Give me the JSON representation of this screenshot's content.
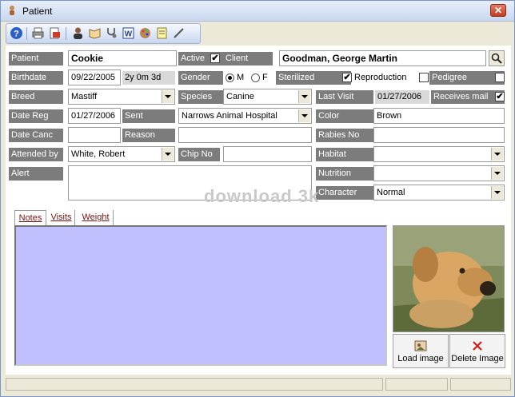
{
  "window": {
    "title": "Patient",
    "close_label": "✕"
  },
  "toolbar": {
    "icons": [
      "help-icon",
      "print-icon",
      "report-icon",
      "person-icon",
      "book-icon",
      "stethoscope-icon",
      "word-icon",
      "palette-icon",
      "note-icon",
      "pen-icon"
    ]
  },
  "labels": {
    "patient": "Patient",
    "active": "Active",
    "client": "Client",
    "birthdate": "Birthdate",
    "gender": "Gender",
    "sterilized": "Sterilized",
    "reproduction": "Reproduction",
    "pedigree": "Pedigree",
    "breed": "Breed",
    "species": "Species",
    "last_visit": "Last Visit",
    "receives_mail": "Receives mail",
    "date_reg": "Date Reg",
    "sent": "Sent",
    "color": "Color",
    "date_canc": "Date Canc",
    "reason": "Reason",
    "rabies_no": "Rabies No",
    "attended_by": "Attended by",
    "chip_no": "Chip No",
    "habitat": "Habitat",
    "alert": "Alert",
    "nutrition": "Nutrition",
    "character": "Character",
    "gender_m": "M",
    "gender_f": "F"
  },
  "values": {
    "patient": "Cookie",
    "client": "Goodman, George Martin",
    "birthdate": "09/22/2005",
    "age": "2y 0m 3d",
    "breed": "Mastiff",
    "species": "Canine",
    "last_visit": "01/27/2006",
    "date_reg": "01/27/2006",
    "sent": "Narrows Animal Hospital",
    "color": "Brown",
    "date_canc": "",
    "reason": "",
    "rabies_no": "",
    "attended_by": "White, Robert",
    "chip_no": "",
    "habitat": "",
    "nutrition": "",
    "character": "Normal",
    "alert": "",
    "active_check": "✔",
    "sterilized_check": "✔",
    "reproduction_check": "",
    "pedigree_check": "",
    "receives_mail_check": "✔"
  },
  "tabs": [
    {
      "label": "Notes",
      "active": true
    },
    {
      "label": "Visits",
      "active": false
    },
    {
      "label": "Weight",
      "active": false
    }
  ],
  "buttons": {
    "load_image": "Load image",
    "delete_image": "Delete Image"
  },
  "watermark": "download 3k",
  "colors": {
    "notes_bg": "#c0c0ff",
    "label_bg": "#7c7c7c",
    "tab_text": "#7a1010"
  }
}
